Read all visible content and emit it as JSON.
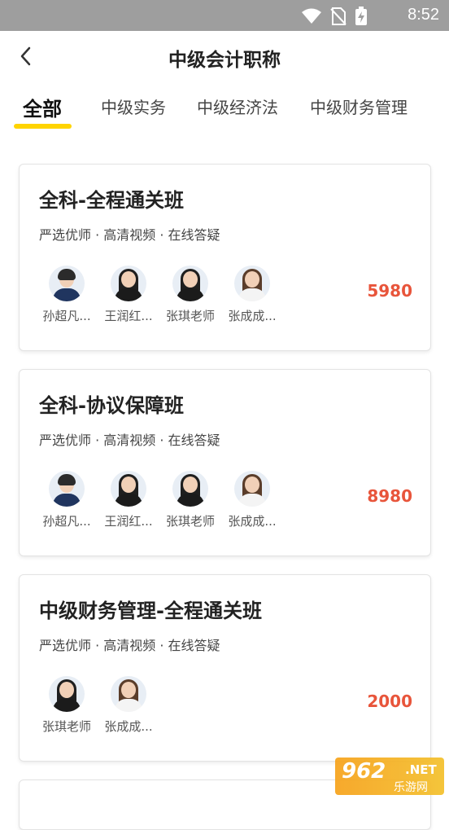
{
  "status": {
    "time": "8:52"
  },
  "header": {
    "title": "中级会计职称"
  },
  "tabs": [
    {
      "label": "全部",
      "active": true
    },
    {
      "label": "中级实务"
    },
    {
      "label": "中级经济法"
    },
    {
      "label": "中级财务管理"
    }
  ],
  "courses": [
    {
      "title": "全科-全程通关班",
      "subtitle": "严选优师 · 高清视频 · 在线答疑",
      "price": "5980",
      "teachers": [
        "孙超凡...",
        "王润红...",
        "张琪老师",
        "张成成..."
      ]
    },
    {
      "title": "全科-协议保障班",
      "subtitle": "严选优师 · 高清视频 · 在线答疑",
      "price": "8980",
      "teachers": [
        "孙超凡...",
        "王润红...",
        "张琪老师",
        "张成成..."
      ]
    },
    {
      "title": "中级财务管理-全程通关班",
      "subtitle": "严选优师 · 高清视频 · 在线答疑",
      "price": "2000",
      "teachers": [
        "张琪老师",
        "张成成..."
      ]
    }
  ],
  "watermark": {
    "number": "962",
    "suffix": ".NET",
    "site": "乐游网"
  },
  "colors": {
    "accent": "#ffd400",
    "price": "#e8553b"
  }
}
